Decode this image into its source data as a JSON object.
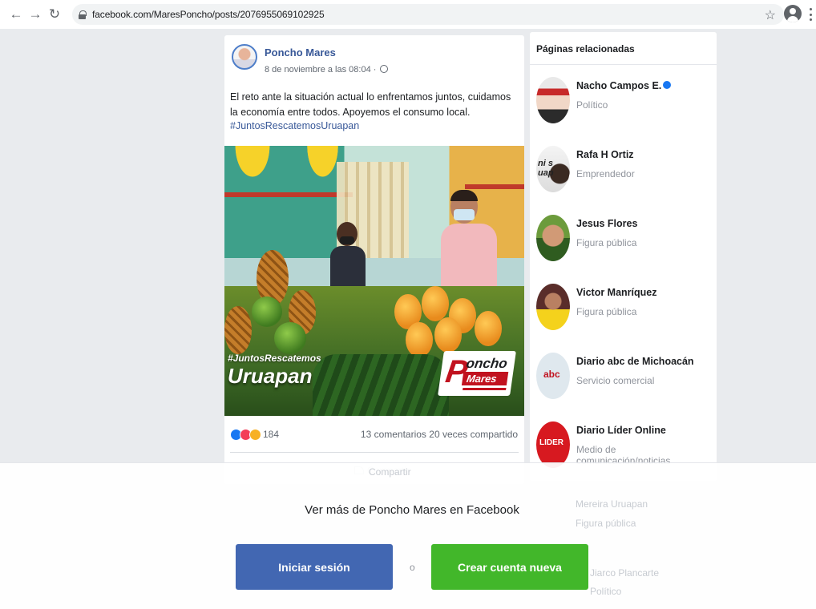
{
  "browser": {
    "url": "facebook.com/MaresPoncho/posts/2076955069102925"
  },
  "post": {
    "author": "Poncho Mares",
    "date": "8 de noviembre a las 08:04 ·",
    "text": "El reto ante la situación actual lo enfrentamos juntos, cuidamos la economía entre todos. Apoyemos el consumo local.",
    "hashtag": "#JuntosRescatemosUruapan",
    "image_overlay": {
      "tag": "#JuntosRescatemos",
      "city": "Uruapan",
      "logo_line1": "oncho",
      "logo_line2": "Mares",
      "logo_initial": "P"
    },
    "reaction_count": "184",
    "comments_shares": "13 comentarios  20 veces compartido",
    "share_label": "Compartir"
  },
  "related": {
    "title": "Páginas relacionadas",
    "pages": [
      {
        "name": "Nacho Campos E.",
        "category": "Político",
        "verified": true
      },
      {
        "name": "Rafa H Ortiz",
        "category": "Emprendedor",
        "avatar_text": "ni s\nuap"
      },
      {
        "name": "Jesus Flores",
        "category": "Figura pública"
      },
      {
        "name": "Victor Manríquez",
        "category": "Figura pública"
      },
      {
        "name": "Diario abc de Michoacán",
        "category": "Servicio comercial",
        "avatar_text": "abc"
      },
      {
        "name": "Diario Líder Online",
        "category": "Medio de comunicación/noticias",
        "avatar_text": "LIDER"
      }
    ],
    "faded": [
      {
        "name": "Mereira Uruapan",
        "category": "Figura pública"
      },
      {
        "name": "Jiarco Plancarte",
        "category": "Político"
      }
    ]
  },
  "login_overlay": {
    "title": "Ver más de Poncho Mares en Facebook",
    "login_label": "Iniciar sesión",
    "or_label": "o",
    "create_label": "Crear cuenta nueva"
  },
  "colors": {
    "facebook_blue": "#4267b2",
    "create_green": "#42b72a",
    "link_blue": "#385898"
  },
  "icons": [
    "back-arrow-icon",
    "forward-arrow-icon",
    "reload-icon",
    "lock-icon",
    "star-icon",
    "profile-icon",
    "menu-icon",
    "globe-icon",
    "share-icon",
    "verified-icon"
  ]
}
